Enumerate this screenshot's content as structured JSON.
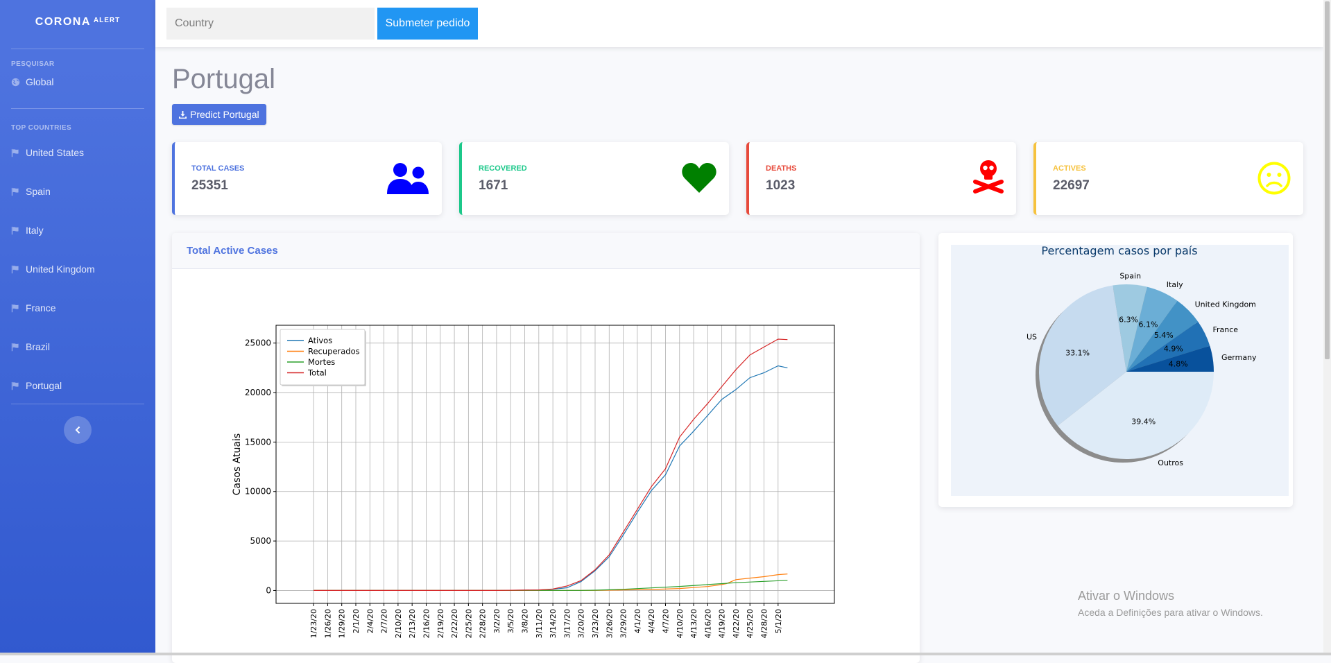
{
  "sidebar": {
    "brand": "CORONA",
    "brand_sup": "ALERT",
    "section_search": "PESQUISAR",
    "global": "Global",
    "section_top": "TOP COUNTRIES",
    "countries": [
      "United States",
      "Spain",
      "Italy",
      "United Kingdom",
      "France",
      "Brazil",
      "Portugal"
    ],
    "toggle_icon": "chevron-left-icon"
  },
  "topbar": {
    "country_placeholder": "Country",
    "country_value": "",
    "submit_label": "Submeter pedido"
  },
  "page": {
    "title": "Portugal",
    "predict_label": "Predict Portugal"
  },
  "cards": {
    "total": {
      "label": "TOTAL CASES",
      "value": "25351",
      "color": "#4e73df",
      "icon": "users-icon",
      "icon_color": "#0000ff"
    },
    "recovered": {
      "label": "RECOVERED",
      "value": "1671",
      "color": "#1cc88a",
      "icon": "heart-icon",
      "icon_color": "#008000"
    },
    "deaths": {
      "label": "DEATHS",
      "value": "1023",
      "color": "#e74a3b",
      "icon": "skull-crossbones-icon",
      "icon_color": "#ff0000"
    },
    "actives": {
      "label": "ACTIVES",
      "value": "22697",
      "color": "#f6c23e",
      "icon": "sad-face-icon",
      "icon_color": "#ffff00"
    }
  },
  "panels": {
    "line_title": "Total Active Cases"
  },
  "watermark": {
    "title": "Ativar o Windows",
    "subtitle": "Aceda a Definições para ativar o Windows."
  },
  "chart_data": [
    {
      "type": "line",
      "ylabel": "Casos Atuais",
      "ylim": [
        -1300,
        26800
      ],
      "yticks": [
        0,
        5000,
        10000,
        15000,
        20000,
        25000
      ],
      "xlim": [
        -8,
        111
      ],
      "grid": true,
      "legend": "top-left",
      "x_start": "1/23/20",
      "x_tick_labels": [
        "1/23/20",
        "1/26/20",
        "1/29/20",
        "2/1/20",
        "2/4/20",
        "2/7/20",
        "2/10/20",
        "2/13/20",
        "2/16/20",
        "2/19/20",
        "2/22/20",
        "2/25/20",
        "2/28/20",
        "3/2/20",
        "3/5/20",
        "3/8/20",
        "3/11/20",
        "3/14/20",
        "3/17/20",
        "3/20/20",
        "3/23/20",
        "3/26/20",
        "3/29/20",
        "4/1/20",
        "4/4/20",
        "4/7/20",
        "4/10/20",
        "4/13/20",
        "4/16/20",
        "4/19/20",
        "4/22/20",
        "4/25/20",
        "4/28/20",
        "5/1/20"
      ],
      "series": [
        {
          "name": "Ativos",
          "color": "#1f77b4",
          "points": [
            [
              "1/23/20",
              0
            ],
            [
              "3/2/20",
              0
            ],
            [
              "3/11/20",
              50
            ],
            [
              "3/14/20",
              120
            ],
            [
              "3/17/20",
              280
            ],
            [
              "3/20/20",
              900
            ],
            [
              "3/23/20",
              2000
            ],
            [
              "3/26/20",
              3400
            ],
            [
              "3/29/20",
              5600
            ],
            [
              "4/1/20",
              7900
            ],
            [
              "4/4/20",
              10100
            ],
            [
              "4/7/20",
              11700
            ],
            [
              "4/10/20",
              14600
            ],
            [
              "4/13/20",
              16100
            ],
            [
              "4/16/20",
              17700
            ],
            [
              "4/19/20",
              19300
            ],
            [
              "4/22/20",
              20300
            ],
            [
              "4/25/20",
              21500
            ],
            [
              "4/28/20",
              22000
            ],
            [
              "5/1/20",
              22700
            ],
            [
              "5/3/20",
              22500
            ]
          ]
        },
        {
          "name": "Recuperados",
          "color": "#ff7f0e",
          "points": [
            [
              "1/23/20",
              0
            ],
            [
              "3/23/20",
              10
            ],
            [
              "3/29/20",
              50
            ],
            [
              "4/4/20",
              100
            ],
            [
              "4/10/20",
              200
            ],
            [
              "4/16/20",
              400
            ],
            [
              "4/19/20",
              600
            ],
            [
              "4/20/20",
              700
            ],
            [
              "4/22/20",
              1100
            ],
            [
              "4/25/20",
              1250
            ],
            [
              "4/28/20",
              1400
            ],
            [
              "5/1/20",
              1600
            ],
            [
              "5/3/20",
              1671
            ]
          ]
        },
        {
          "name": "Mortes",
          "color": "#2ca02c",
          "points": [
            [
              "1/23/20",
              0
            ],
            [
              "3/20/20",
              10
            ],
            [
              "3/23/20",
              30
            ],
            [
              "3/29/20",
              120
            ],
            [
              "4/4/20",
              260
            ],
            [
              "4/10/20",
              410
            ],
            [
              "4/16/20",
              600
            ],
            [
              "4/22/20",
              785
            ],
            [
              "4/28/20",
              920
            ],
            [
              "5/3/20",
              1023
            ]
          ]
        },
        {
          "name": "Total",
          "color": "#d62728",
          "points": [
            [
              "1/23/20",
              0
            ],
            [
              "3/2/20",
              0
            ],
            [
              "3/11/20",
              60
            ],
            [
              "3/14/20",
              150
            ],
            [
              "3/17/20",
              450
            ],
            [
              "3/20/20",
              1000
            ],
            [
              "3/23/20",
              2100
            ],
            [
              "3/26/20",
              3600
            ],
            [
              "3/29/20",
              5900
            ],
            [
              "4/1/20",
              8200
            ],
            [
              "4/4/20",
              10500
            ],
            [
              "4/7/20",
              12300
            ],
            [
              "4/10/20",
              15500
            ],
            [
              "4/13/20",
              17300
            ],
            [
              "4/16/20",
              18900
            ],
            [
              "4/19/20",
              20600
            ],
            [
              "4/22/20",
              22300
            ],
            [
              "4/25/20",
              23800
            ],
            [
              "4/28/20",
              24600
            ],
            [
              "5/1/20",
              25400
            ],
            [
              "5/3/20",
              25351
            ]
          ]
        }
      ]
    },
    {
      "type": "pie",
      "title": "Percentagem casos por país",
      "slices": [
        {
          "label": "Germany",
          "pct": 4.8,
          "pct_label": "4.8%",
          "color": "#08519c"
        },
        {
          "label": "France",
          "pct": 4.9,
          "pct_label": "4.9%",
          "color": "#2171b5"
        },
        {
          "label": "United Kingdom",
          "pct": 5.4,
          "pct_label": "5.4%",
          "color": "#4292c6"
        },
        {
          "label": "Italy",
          "pct": 6.1,
          "pct_label": "6.1%",
          "color": "#6baed6"
        },
        {
          "label": "Spain",
          "pct": 6.3,
          "pct_label": "6.3%",
          "color": "#9ecae1"
        },
        {
          "label": "US",
          "pct": 33.1,
          "pct_label": "33.1%",
          "color": "#c6dbef"
        },
        {
          "label": "Outros",
          "pct": 39.4,
          "pct_label": "39.4%",
          "color": "#deebf7"
        }
      ]
    }
  ]
}
